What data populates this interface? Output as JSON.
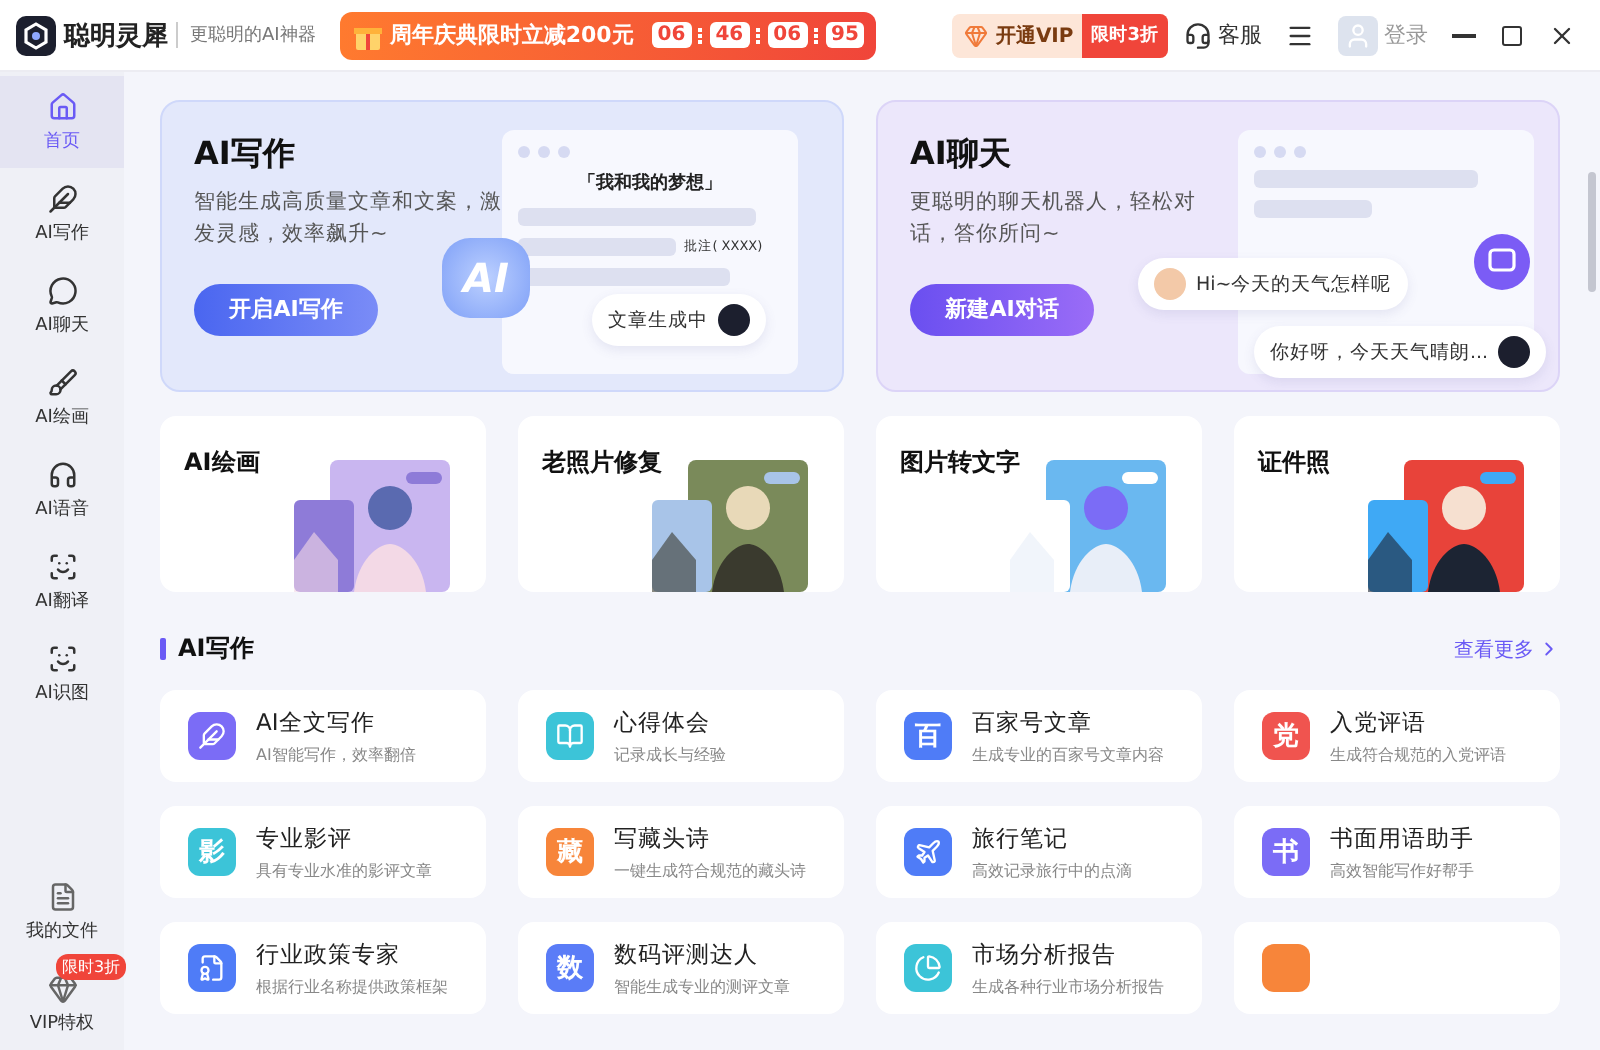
{
  "app": {
    "name": "聪明灵犀",
    "tagline": "更聪明的AI神器"
  },
  "promo": {
    "text": "周年庆典限时立减200元",
    "countdown": [
      "06",
      "46",
      "06",
      "95"
    ]
  },
  "vip": {
    "label": "开通VIP",
    "badge": "限时3折"
  },
  "service": "客服",
  "login": "登录",
  "sidebar": {
    "items": [
      {
        "label": "首页",
        "selected": true
      },
      {
        "label": "AI写作",
        "selected": false
      },
      {
        "label": "AI聊天",
        "selected": false
      },
      {
        "label": "AI绘画",
        "selected": false
      },
      {
        "label": "AI语音",
        "selected": false
      },
      {
        "label": "AI翻译",
        "selected": false
      },
      {
        "label": "AI识图",
        "selected": false
      }
    ],
    "bottom": [
      {
        "label": "我的文件"
      },
      {
        "label": "VIP特权",
        "badge": "限时3折"
      }
    ]
  },
  "hero": [
    {
      "kind": "write",
      "title": "AI写作",
      "desc": "智能生成高质量文章和文案，激发灵感，效率飙升~",
      "button": "开启AI写作",
      "doc_title": "「我和我的梦想」",
      "note": "批注( XXXX)",
      "ai_badge": "AI",
      "status": "文章生成中"
    },
    {
      "kind": "chat",
      "title": "AI聊天",
      "desc": "更聪明的聊天机器人，轻松对话，答你所问~",
      "button": "新建AI对话",
      "question": "Hi~今天的天气怎样呢",
      "answer": "你好呀，今天天气晴朗..."
    }
  ],
  "features": [
    {
      "title": "AI绘画",
      "kind": "picture"
    },
    {
      "title": "老照片修复",
      "kind": "picture"
    },
    {
      "title": "图片转文字",
      "kind": "picture"
    },
    {
      "title": "证件照",
      "kind": "picture"
    }
  ],
  "section": {
    "title": "AI写作",
    "more": "查看更多"
  },
  "tools": [
    {
      "name": "AI全文写作",
      "desc": "AI智能写作，效率翻倍",
      "color": "#7b6cf6"
    },
    {
      "name": "心得体会",
      "desc": "记录成长与经验",
      "color": "#3cc4d8"
    },
    {
      "name": "百家号文章",
      "desc": "生成专业的百家号文章内容",
      "glyph": "百",
      "color": "#4f7cf7"
    },
    {
      "name": "入党评语",
      "desc": "生成符合规范的入党评语",
      "glyph": "党",
      "color": "#f0544f"
    },
    {
      "name": "专业影评",
      "desc": "具有专业水准的影评文章",
      "glyph": "影",
      "color": "#3cc4d8"
    },
    {
      "name": "写藏头诗",
      "desc": "一键生成符合规范的藏头诗",
      "glyph": "藏",
      "color": "#f7853a"
    },
    {
      "name": "旅行笔记",
      "desc": "高效记录旅行中的点滴",
      "color": "#4f7cf7"
    },
    {
      "name": "书面用语助手",
      "desc": "高效智能写作好帮手",
      "glyph": "书",
      "color": "#7b6cf6"
    },
    {
      "name": "行业政策专家",
      "desc": "根据行业名称提供政策框架",
      "color": "#4f7cf7"
    },
    {
      "name": "数码评测达人",
      "desc": "智能生成专业的测评文章",
      "glyph": "数",
      "color": "#5a7cf7"
    },
    {
      "name": "市场分析报告",
      "desc": "生成各种行业市场分析报告",
      "color": "#3cc4d8"
    },
    {
      "color": "#f7853a"
    }
  ]
}
